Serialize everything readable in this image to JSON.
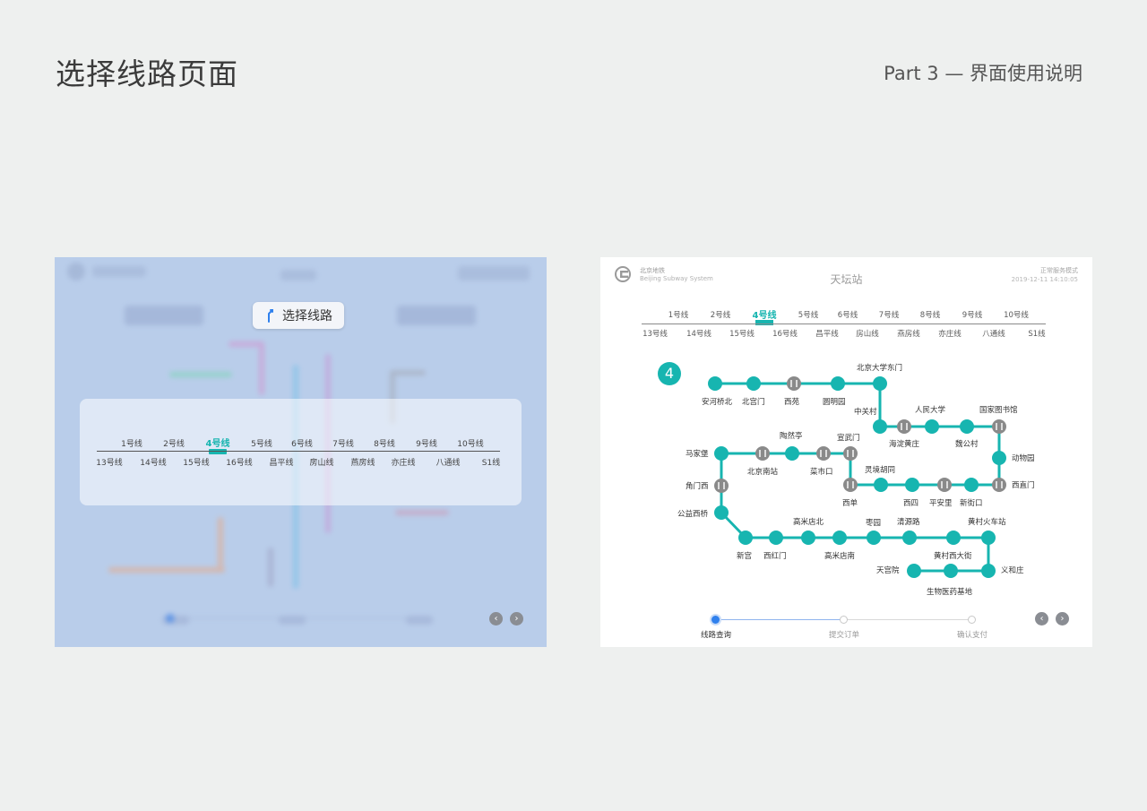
{
  "page": {
    "title": "选择线路页面",
    "part": "Part 3 — 界面使用说明"
  },
  "left_screen": {
    "select_route_button": "选择线路",
    "row1": [
      "1号线",
      "2号线",
      "4号线",
      "5号线",
      "6号线",
      "7号线",
      "8号线",
      "9号线",
      "10号线"
    ],
    "row2": [
      "13号线",
      "14号线",
      "15号线",
      "16号线",
      "昌平线",
      "房山线",
      "燕房线",
      "亦庄线",
      "八通线",
      "S1线"
    ],
    "active_line": "4号线",
    "nav_prev": "‹",
    "nav_next": "›"
  },
  "right_screen": {
    "brand_cn": "北京地铁",
    "brand_en": "Beijing Subway System",
    "station_title": "天坛站",
    "mode": "正常服务模式",
    "datetime": "2019-12-11  14:10:05",
    "row1": [
      "1号线",
      "2号线",
      "4号线",
      "5号线",
      "6号线",
      "7号线",
      "8号线",
      "9号线",
      "10号线"
    ],
    "row2": [
      "13号线",
      "14号线",
      "15号线",
      "16号线",
      "昌平线",
      "房山线",
      "燕房线",
      "亦庄线",
      "八通线",
      "S1线"
    ],
    "active_line": "4号线",
    "line_number": "4",
    "stations": {
      "anhe_qiaobei": "安河桥北",
      "beigongmen": "北宫门",
      "xiyuan": "西苑",
      "yuanmingyuan": "圆明园",
      "beida_dongmen": "北京大学东门",
      "zhongguancun": "中关村",
      "haidian_huangzhuang": "海淀黄庄",
      "renmin_daxue": "人民大学",
      "weigongcun": "魏公村",
      "guojia_tushuguan": "国家图书馆",
      "dongwuyuan": "动物园",
      "xizhimen": "西直门",
      "xinjiekou": "新街口",
      "pinganli": "平安里",
      "xisi": "西四",
      "lingjing_hutong": "灵境胡同",
      "xidan": "西单",
      "xuanwumen": "宣武门",
      "caishikou": "菜市口",
      "taoranting": "陶然亭",
      "beijing_nanzhan": "北京南站",
      "majiapu": "马家堡",
      "jiaomenxi": "角门西",
      "gongyixiqiao": "公益西桥",
      "xingong": "新宫",
      "xihongmen": "西红门",
      "gaomidian_bei": "高米店北",
      "gaomidian_nan": "高米店南",
      "zaoyuan": "枣园",
      "qingyuanlu": "清源路",
      "huangcun_xidajie": "黄村西大街",
      "huangcun_huochezhan": "黄村火车站",
      "yihezhuang": "义和庄",
      "shengwu_yiyao_jidi": "生物医药基地",
      "tiangongyuan": "天宫院"
    },
    "steps": [
      "线路查询",
      "提交订单",
      "确认支付"
    ],
    "nav_prev": "‹",
    "nav_next": "›"
  },
  "colors": {
    "teal": "#17b5b0",
    "transfer": "#8a8a8a",
    "step_active": "#2f80ed",
    "left_overlay": "#b9cdea"
  },
  "icons": {
    "route": "route-branch-icon",
    "logo": "beijing-subway-logo-icon",
    "transfer": "transfer-station-icon"
  }
}
